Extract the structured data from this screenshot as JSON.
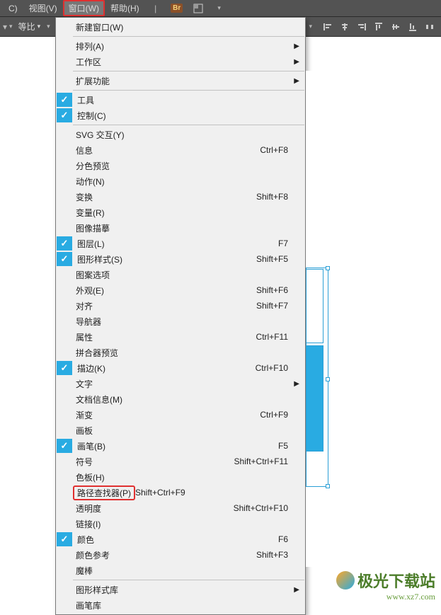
{
  "menubar": {
    "cut": "C)",
    "view": "视图(V)",
    "window": "窗口(W)",
    "help": "帮助(H)",
    "bridge": "Br"
  },
  "toolbar": {
    "ratio": "等比"
  },
  "menu": {
    "new_window": "新建窗口(W)",
    "arrange": "排列(A)",
    "workspace": "工作区",
    "extensions": "扩展功能",
    "tools": "工具",
    "control": "控制(C)",
    "svg": "SVG 交互(Y)",
    "info": {
      "label": "信息",
      "shortcut": "Ctrl+F8"
    },
    "sep_preview": "分色预览",
    "actions": "动作(N)",
    "transform": {
      "label": "变换",
      "shortcut": "Shift+F8"
    },
    "variables": "变量(R)",
    "image_trace": "图像描摹",
    "layers": {
      "label": "图层(L)",
      "shortcut": "F7"
    },
    "graphic_styles": {
      "label": "图形样式(S)",
      "shortcut": "Shift+F5"
    },
    "pattern_options": "图案选项",
    "appearance": {
      "label": "外观(E)",
      "shortcut": "Shift+F6"
    },
    "align": {
      "label": "对齐",
      "shortcut": "Shift+F7"
    },
    "navigator": "导航器",
    "attributes": {
      "label": "属性",
      "shortcut": "Ctrl+F11"
    },
    "flattener": "拼合器预览",
    "stroke": {
      "label": "描边(K)",
      "shortcut": "Ctrl+F10"
    },
    "text": "文字",
    "doc_info": "文档信息(M)",
    "gradient": {
      "label": "渐变",
      "shortcut": "Ctrl+F9"
    },
    "artboards": "画板",
    "brushes": {
      "label": "画笔(B)",
      "shortcut": "F5"
    },
    "symbols": {
      "label": "符号",
      "shortcut": "Shift+Ctrl+F11"
    },
    "swatches": "色板(H)",
    "pathfinder": {
      "label": "路径查找器(P)",
      "shortcut": "Shift+Ctrl+F9"
    },
    "transparency": {
      "label": "透明度",
      "shortcut": "Shift+Ctrl+F10"
    },
    "links": "链接(I)",
    "color": {
      "label": "颜色",
      "shortcut": "F6"
    },
    "color_guide": {
      "label": "颜色参考",
      "shortcut": "Shift+F3"
    },
    "magic_wand": "魔棒",
    "style_lib": "图形样式库",
    "brush_lib_cut": "画笔库"
  },
  "watermark": {
    "title": "极光下载站",
    "url": "www.xz7.com"
  }
}
